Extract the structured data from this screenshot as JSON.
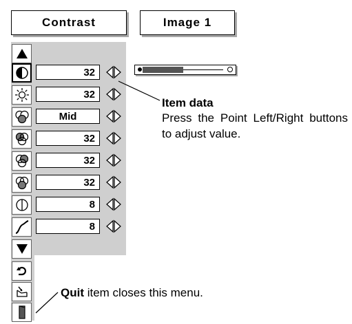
{
  "header": {
    "menu_title": "Contrast",
    "image_mode": "Image 1"
  },
  "nav": {
    "up_icon": "triangle-up-icon",
    "down_icon": "triangle-down-icon",
    "reset_icon": "reset-arrow-icon",
    "store_icon": "store-tray-icon",
    "quit_icon": "quit-door-icon"
  },
  "items": [
    {
      "icon": "contrast-icon",
      "value": "32",
      "selected": true
    },
    {
      "icon": "brightness-sun-icon",
      "value": "32"
    },
    {
      "icon": "color-temp-icon",
      "value": "Mid"
    },
    {
      "icon": "white-balance-red-icon",
      "value": "32"
    },
    {
      "icon": "white-balance-green-icon",
      "value": "32"
    },
    {
      "icon": "white-balance-blue-icon",
      "value": "32"
    },
    {
      "icon": "sharpness-icon",
      "value": "8"
    },
    {
      "icon": "gamma-curve-icon",
      "value": "8"
    }
  ],
  "slider": {
    "level": 0.5
  },
  "callout": {
    "title": "Item data",
    "body": "Press the Point Left/Right buttons to adjust value."
  },
  "quit_note": {
    "bold": "Quit",
    "rest": " item closes this menu."
  },
  "colors": {
    "panel": "#cfcfcf",
    "shadow": "#a8a8a8",
    "slider_fill": "#555555"
  }
}
